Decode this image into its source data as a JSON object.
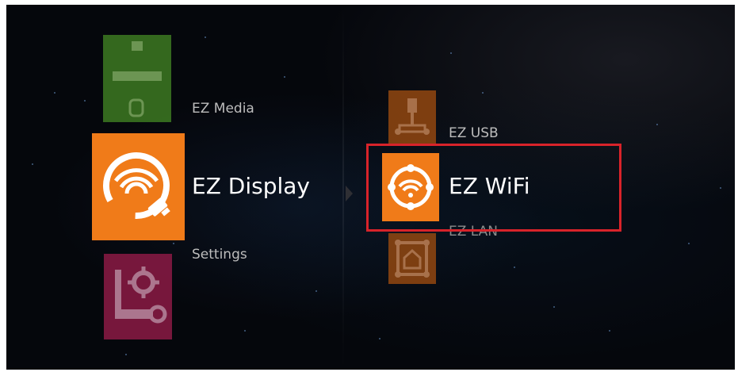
{
  "left_menu": {
    "items": [
      {
        "label": "EZ Media",
        "icon": "media-icon",
        "color": "#3d7a22",
        "state": "faded"
      },
      {
        "label": "EZ Display",
        "icon": "wifi-display-icon",
        "color": "#f07b19",
        "state": "selected"
      },
      {
        "label": "Settings",
        "icon": "settings-icon",
        "color": "#8b1a45",
        "state": "faded"
      }
    ]
  },
  "right_menu": {
    "items": [
      {
        "label": "EZ USB",
        "icon": "usb-icon",
        "color": "#9b4b10",
        "state": "faded"
      },
      {
        "label": "EZ WiFi",
        "icon": "wifi-icon",
        "color": "#f07b19",
        "state": "selected"
      },
      {
        "label": "EZ LAN",
        "icon": "lan-icon",
        "color": "#9b4b10",
        "state": "faded"
      }
    ]
  },
  "highlight_color": "#d8232a",
  "submenu_arrow_icon": "chevron-right-icon"
}
